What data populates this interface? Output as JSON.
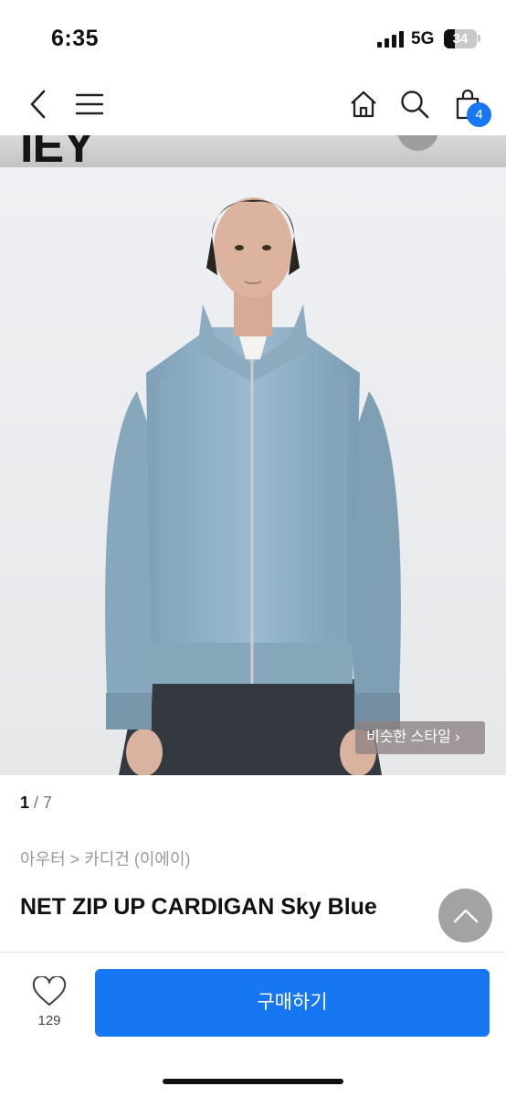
{
  "status": {
    "time": "6:35",
    "network": "5G",
    "battery": "34",
    "battery_level": 0.34
  },
  "nav": {
    "cart_count": "4",
    "icons": [
      "back-icon",
      "menu-icon",
      "home-icon",
      "search-icon",
      "cart-icon"
    ]
  },
  "gallery": {
    "similar_style": "비슷한 스타일 ›",
    "current": "1",
    "total": "/ 7"
  },
  "product": {
    "category": "아우터 > 카디건 (이에이)",
    "title": "NET ZIP UP CARDIGAN Sky Blue"
  },
  "actions": {
    "like_count": "129",
    "buy_label": "구매하기"
  },
  "colors": {
    "accent": "#1777f2",
    "sweater": "#8fb2c9"
  }
}
